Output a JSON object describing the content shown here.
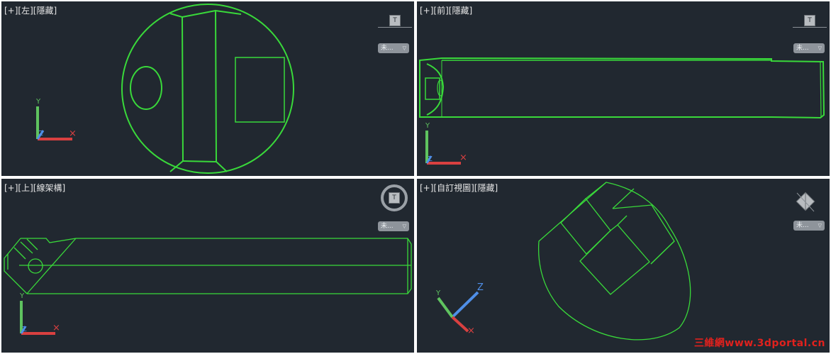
{
  "viewports": {
    "top_left": {
      "label": "[+][左][隱藏]"
    },
    "top_right": {
      "label": "[+][前][隱藏]"
    },
    "bottom_left": {
      "label": "[+][上][線架構]"
    },
    "bottom_right": {
      "label": "[+][自訂視圖][隱藏]"
    }
  },
  "viewcube": {
    "face_label": "T"
  },
  "wcs_menu": {
    "label": "未...",
    "caret": "▽"
  },
  "axes": {
    "x": "X",
    "y": "Y",
    "z": "Z"
  },
  "colors": {
    "geometry": "#39d93a",
    "background": "#212830",
    "x_axis": "#d94040",
    "y_axis": "#5fc35f",
    "z_axis": "#4f8fe8",
    "watermark": "#e0211d"
  },
  "watermark": "三維網www.3dportal.cn"
}
